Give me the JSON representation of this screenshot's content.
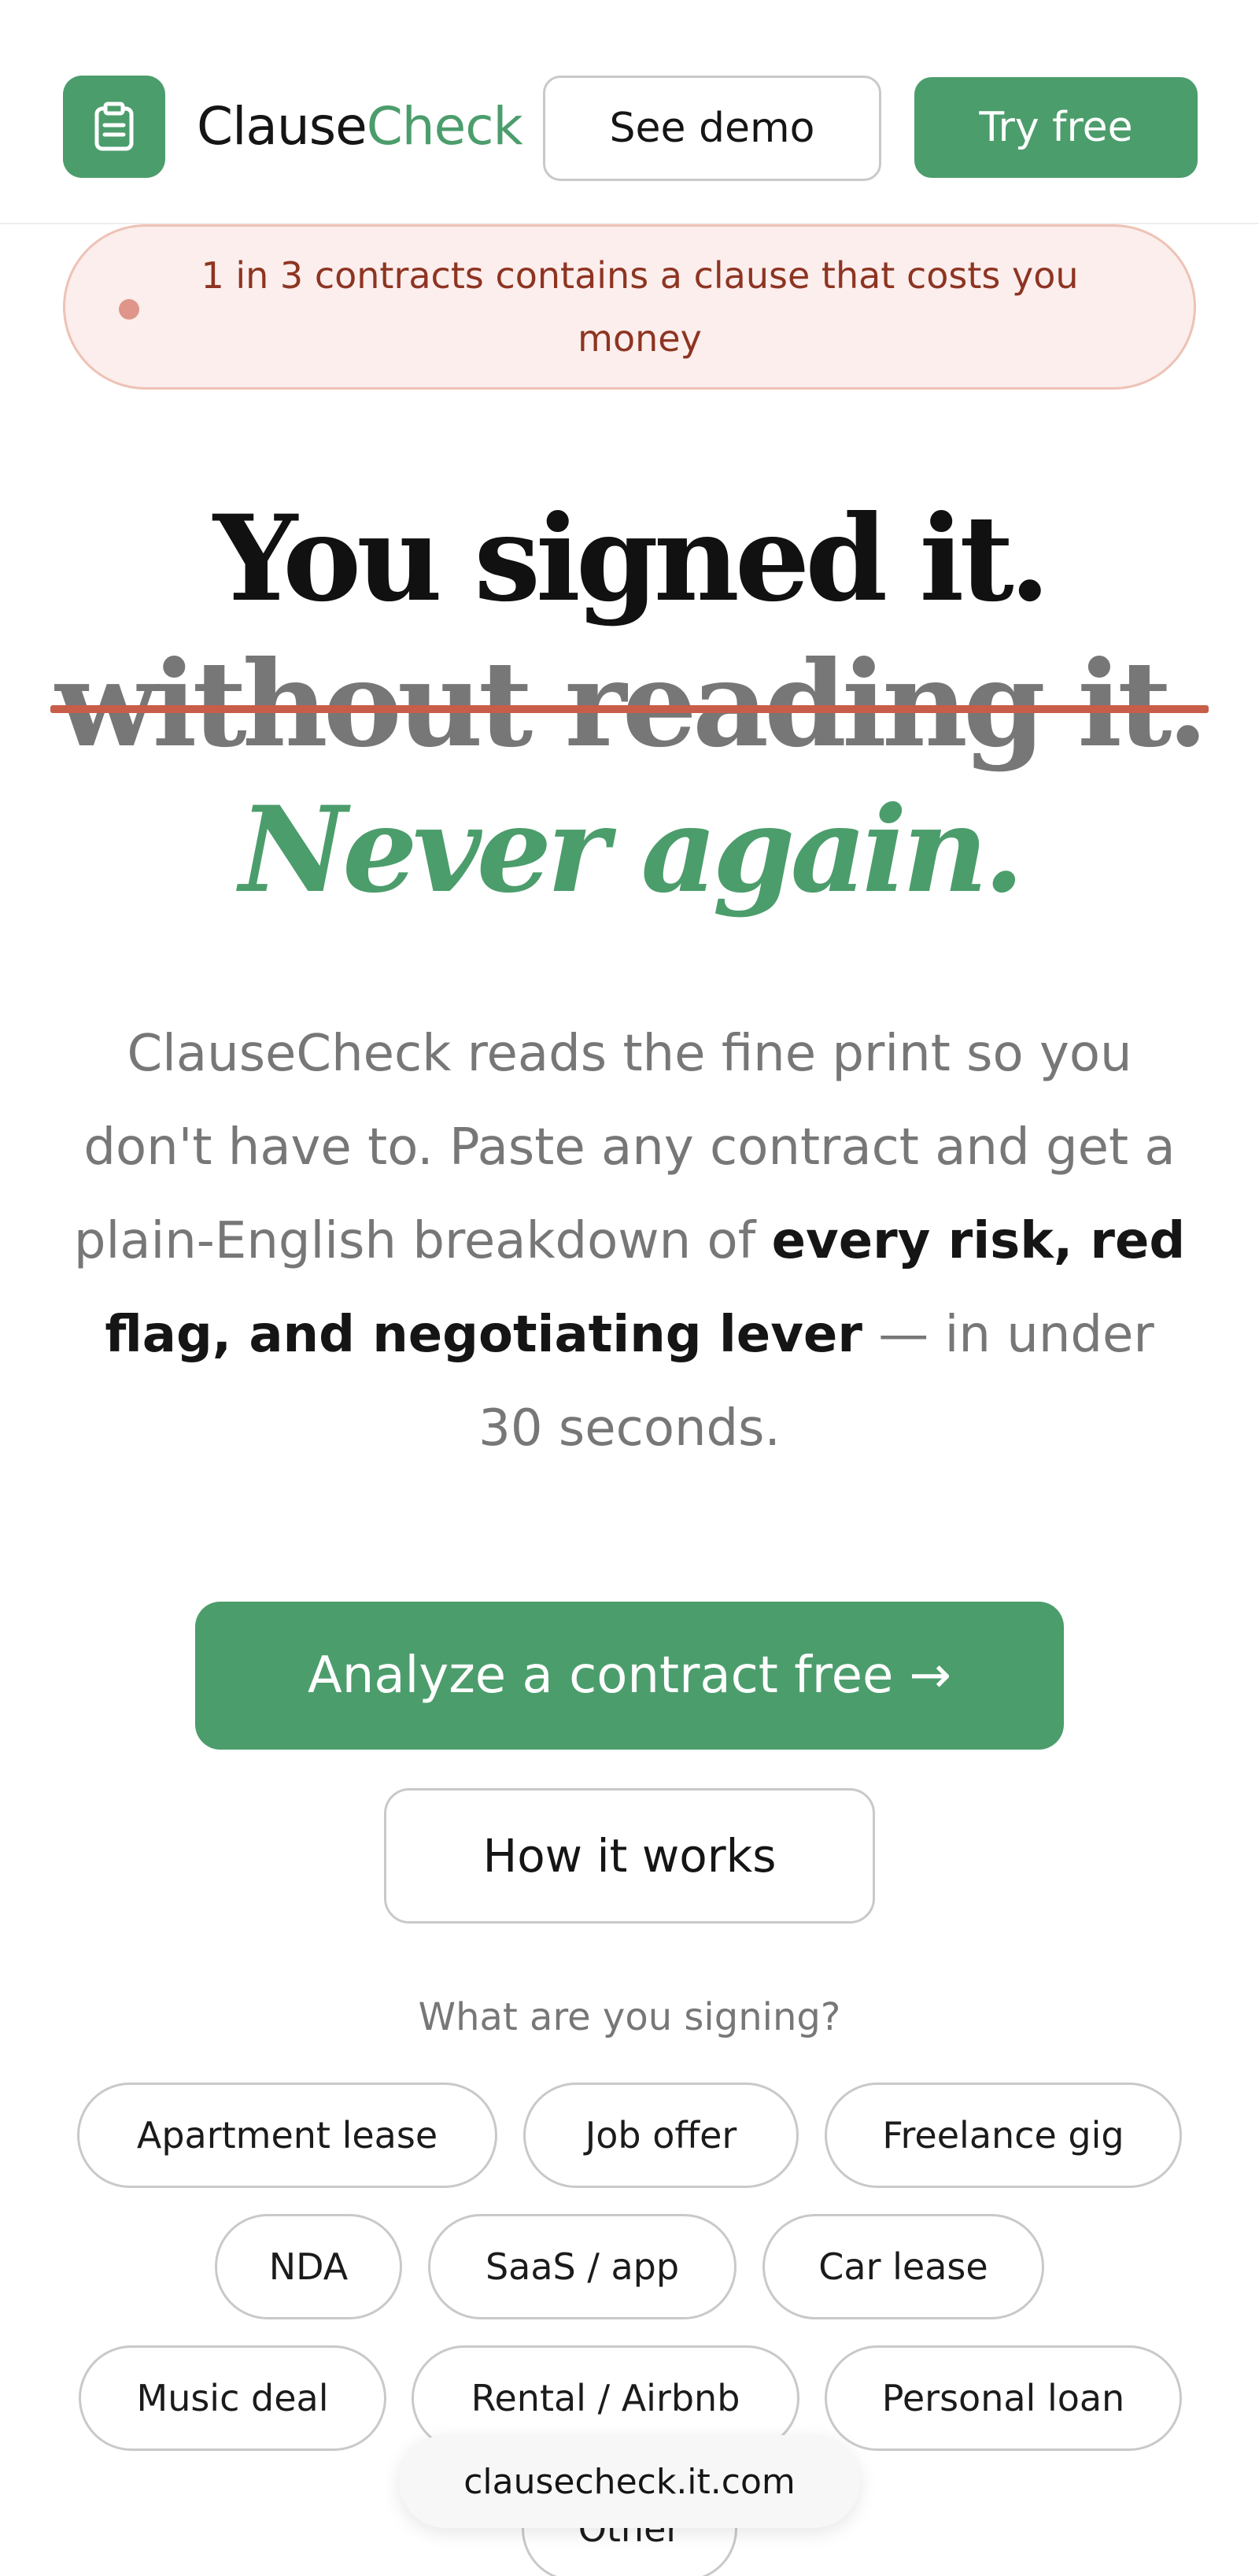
{
  "header": {
    "brand_part1": "Clause",
    "brand_part2": "Check",
    "demo_label": "See demo",
    "try_label": "Try free",
    "logo_icon": "clipboard-icon"
  },
  "alert": {
    "text": "1 in 3 contracts contains a clause that costs you money"
  },
  "headline": {
    "line1": "You signed it.",
    "line2": "without reading it.",
    "line3": "Never again."
  },
  "description": {
    "part1": "ClauseCheck reads the fine print so you don't have to. Paste any contract and get a plain-English breakdown of ",
    "bold": "every risk, red flag, and negotiating lever",
    "part2": " — in under 30 seconds."
  },
  "cta": {
    "primary_label": "Analyze a contract free",
    "primary_arrow": "→",
    "secondary_label": "How it works"
  },
  "signing": {
    "label": "What are you signing?",
    "chips": [
      "Apartment lease",
      "Job offer",
      "Freelance gig",
      "NDA",
      "SaaS / app",
      "Car lease",
      "Music deal",
      "Rental / Airbnb",
      "Personal loan",
      "Other"
    ]
  },
  "browser": {
    "url": "clausecheck.it.com"
  },
  "colors": {
    "accent": "#4c9d6c",
    "alert_bg": "#fbeeec",
    "alert_text": "#8e3422",
    "strike": "#c85e49"
  }
}
